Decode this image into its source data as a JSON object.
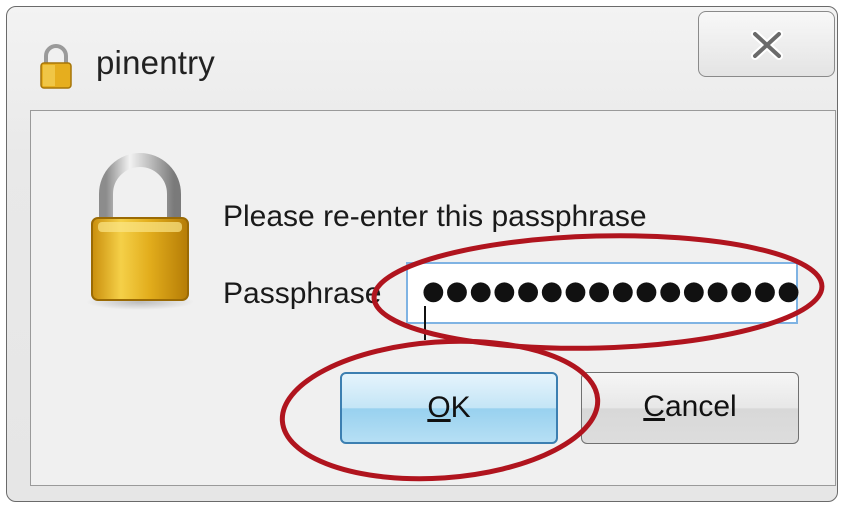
{
  "window": {
    "title": "pinentry"
  },
  "icons": {
    "title_icon": "lock-icon",
    "close_icon": "close-x-icon",
    "dialog_icon": "padlock-icon"
  },
  "dialog": {
    "prompt": "Please re-enter this passphrase",
    "passphrase_label": "Passphrase",
    "passphrase_masked": "●●●●●●●●●●●●●●●●"
  },
  "buttons": {
    "ok": {
      "mnemonic": "O",
      "rest": "K"
    },
    "cancel": {
      "mnemonic": "C",
      "rest": "ancel"
    }
  },
  "colors": {
    "annotation": "#b0141e",
    "ok_accent": "#3c7fb1",
    "lock_gold": "#e0a81a"
  }
}
